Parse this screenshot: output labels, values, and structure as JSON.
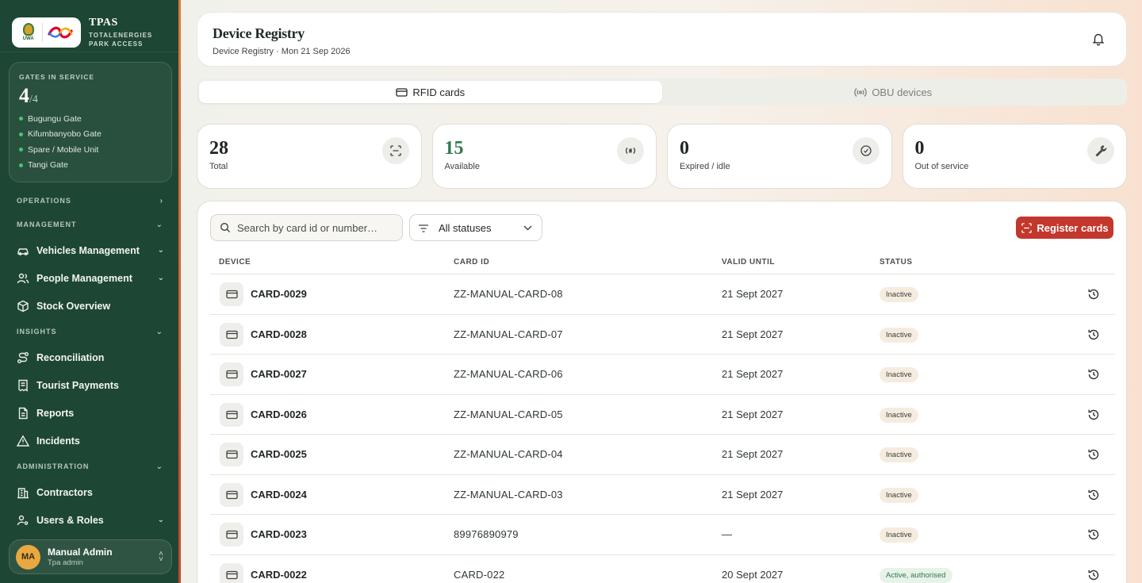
{
  "brand": {
    "name": "TPAS",
    "sub_line1": "TOTALENERGIES",
    "sub_line2": "PARK ACCESS",
    "uwa_text": "UWA"
  },
  "gates": {
    "label": "GATES IN SERVICE",
    "count": "4",
    "total": "/4",
    "items": [
      "Bugungu Gate",
      "Kifumbanyobo Gate",
      "Spare / Mobile Unit",
      "Tangi Gate"
    ]
  },
  "nav": {
    "operations": "OPERATIONS",
    "management": "MANAGEMENT",
    "vehicles": "Vehicles Management",
    "people": "People Management",
    "stock": "Stock Overview",
    "insights": "INSIGHTS",
    "reconciliation": "Reconciliation",
    "tourist_payments": "Tourist Payments",
    "reports": "Reports",
    "incidents": "Incidents",
    "administration": "ADMINISTRATION",
    "contractors": "Contractors",
    "users_roles": "Users & Roles"
  },
  "user": {
    "initials": "MA",
    "name": "Manual Admin",
    "role": "Tpa admin"
  },
  "header": {
    "title": "Device Registry",
    "crumb": "Device Registry · Mon 21 Sep 2026"
  },
  "tabs": {
    "rfid": "RFID cards",
    "obu": "OBU devices"
  },
  "stats": [
    {
      "value": "28",
      "caption": "Total"
    },
    {
      "value": "15",
      "caption": "Available"
    },
    {
      "value": "0",
      "caption": "Expired / idle"
    },
    {
      "value": "0",
      "caption": "Out of service"
    }
  ],
  "toolbar": {
    "search_placeholder": "Search by card id or number…",
    "filter_label": "All statuses",
    "register_label": "Register cards"
  },
  "table": {
    "headers": {
      "device": "DEVICE",
      "card_id": "CARD ID",
      "valid_until": "VALID UNTIL",
      "status": "STATUS"
    },
    "rows": [
      {
        "device": "CARD-0029",
        "card_id": "ZZ-MANUAL-CARD-08",
        "valid_until": "21 Sept 2027",
        "status": "Inactive"
      },
      {
        "device": "CARD-0028",
        "card_id": "ZZ-MANUAL-CARD-07",
        "valid_until": "21 Sept 2027",
        "status": "Inactive"
      },
      {
        "device": "CARD-0027",
        "card_id": "ZZ-MANUAL-CARD-06",
        "valid_until": "21 Sept 2027",
        "status": "Inactive"
      },
      {
        "device": "CARD-0026",
        "card_id": "ZZ-MANUAL-CARD-05",
        "valid_until": "21 Sept 2027",
        "status": "Inactive"
      },
      {
        "device": "CARD-0025",
        "card_id": "ZZ-MANUAL-CARD-04",
        "valid_until": "21 Sept 2027",
        "status": "Inactive"
      },
      {
        "device": "CARD-0024",
        "card_id": "ZZ-MANUAL-CARD-03",
        "valid_until": "21 Sept 2027",
        "status": "Inactive"
      },
      {
        "device": "CARD-0023",
        "card_id": "89976890979",
        "valid_until": "—",
        "status": "Inactive"
      },
      {
        "device": "CARD-0022",
        "card_id": "CARD-022",
        "valid_until": "20 Sept 2027",
        "status": "Active, authorised"
      }
    ]
  },
  "colors": {
    "sidebar": "#1e4634",
    "accent_red": "#c4372c",
    "available_green": "#2f7a4f",
    "gate_dot": "#4cc470"
  }
}
